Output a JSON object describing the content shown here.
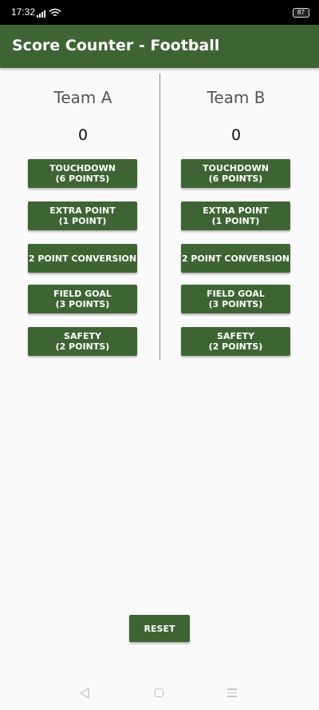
{
  "status_bar": {
    "time": "17:32",
    "battery": "87",
    "icons": [
      "signal-icon",
      "wifi-icon",
      "battery-icon"
    ]
  },
  "app_bar": {
    "title": "Score Counter - Football"
  },
  "team_a": {
    "name": "Team A",
    "score": "0",
    "buttons": {
      "touchdown": "TOUCHDOWN\n(6 POINTS)",
      "extra_point": "EXTRA POINT\n(1 POINT)",
      "two_point": "2 POINT CONVERSION",
      "field_goal": "FIELD GOAL\n(3 POINTS)",
      "safety": "SAFETY\n(2 POINTS)"
    }
  },
  "team_b": {
    "name": "Team B",
    "score": "0",
    "buttons": {
      "touchdown": "TOUCHDOWN\n(6 POINTS)",
      "extra_point": "EXTRA POINT\n(1 POINT)",
      "two_point": "2 POINT CONVERSION",
      "field_goal": "FIELD GOAL\n(3 POINTS)",
      "safety": "SAFETY\n(2 POINTS)"
    }
  },
  "reset_label": "RESET",
  "nav_bar": {
    "icons": [
      "back-icon",
      "home-icon",
      "menu-icon"
    ]
  },
  "colors": {
    "primary": "#3f6434",
    "background": "#fafafa",
    "status_bar": "#000000"
  }
}
